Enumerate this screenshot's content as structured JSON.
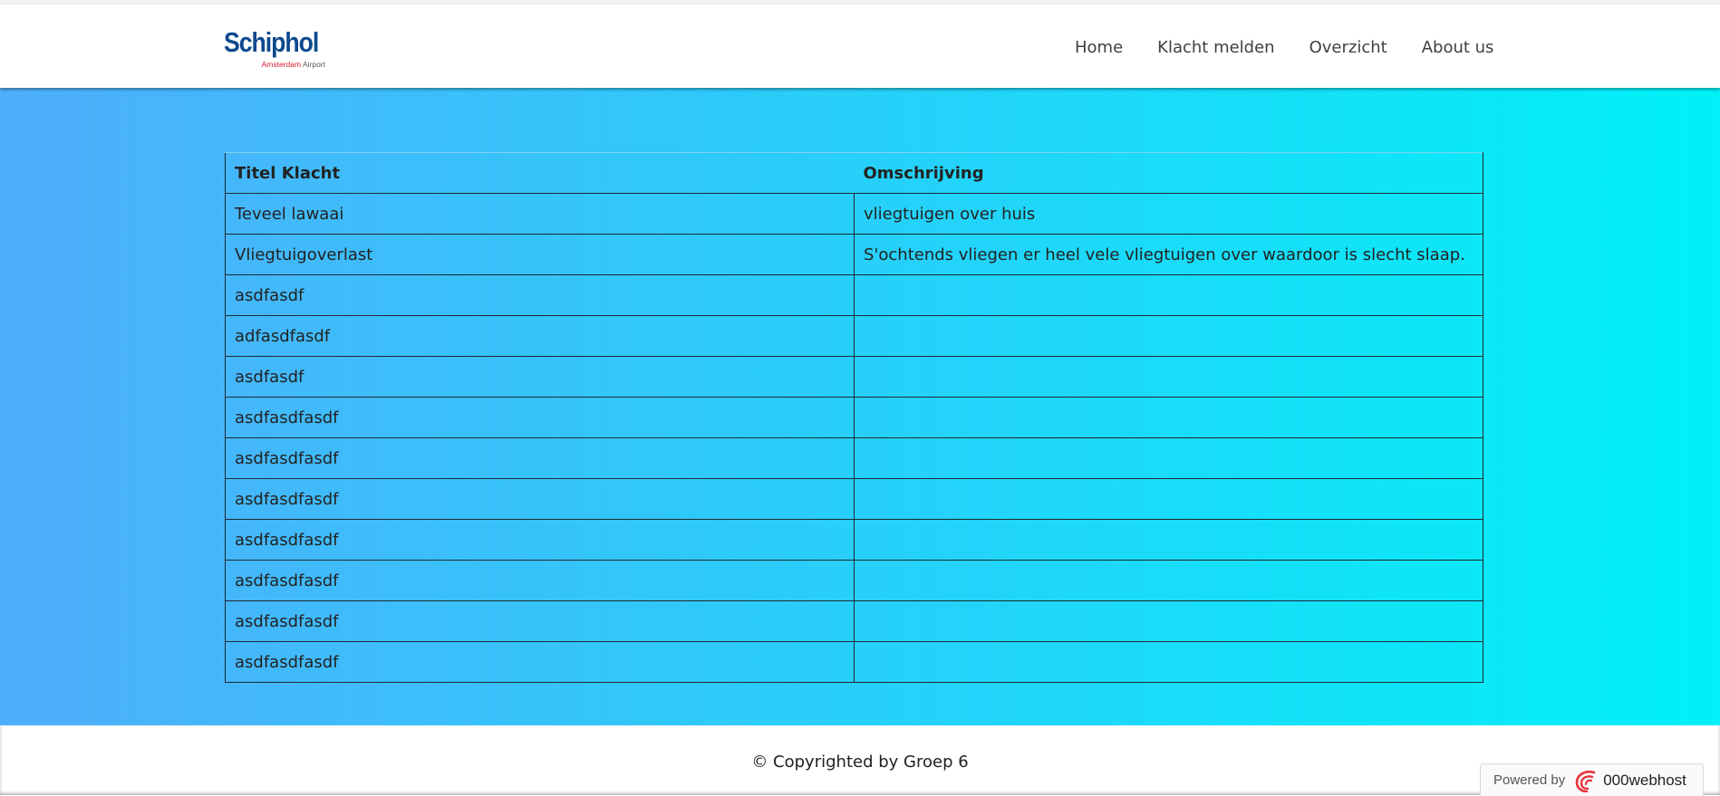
{
  "brand": {
    "name": "Schiphol",
    "sub_red": "Amsterdam",
    "sub_grey": "Airport"
  },
  "nav": {
    "items": [
      "Home",
      "Klacht melden",
      "Overzicht",
      "About us"
    ]
  },
  "table": {
    "headers": [
      "Titel Klacht",
      "Omschrijving"
    ],
    "rows": [
      [
        "Teveel lawaai",
        "vliegtuigen over huis"
      ],
      [
        "Vliegtuigoverlast",
        "S'ochtends vliegen er heel vele vliegtuigen over waardoor is slecht slaap."
      ],
      [
        "asdfasdf",
        ""
      ],
      [
        "adfasdfasdf",
        ""
      ],
      [
        "asdfasdf",
        ""
      ],
      [
        "asdfasdfasdf",
        ""
      ],
      [
        "asdfasdfasdf",
        ""
      ],
      [
        "asdfasdfasdf",
        ""
      ],
      [
        "asdfasdfasdf",
        ""
      ],
      [
        "asdfasdfasdf",
        ""
      ],
      [
        "asdfasdfasdf",
        ""
      ],
      [
        "asdfasdfasdf",
        ""
      ]
    ]
  },
  "footer": {
    "copyright": "© Copyrighted by Groep 6"
  },
  "powered": {
    "label": "Powered by",
    "brand": "000webhost",
    "icon": "000webhost-logo-icon"
  },
  "colors": {
    "gradient_start": "#4faefa",
    "gradient_end": "#00f1f8",
    "logo_blue": "#0d4a8f",
    "logo_red": "#d6202f"
  }
}
